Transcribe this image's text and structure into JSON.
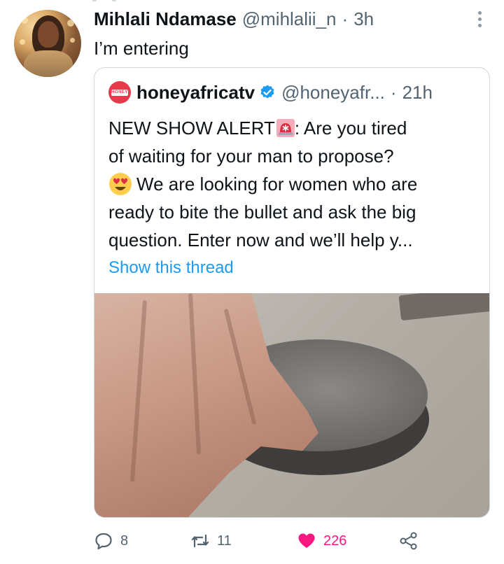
{
  "tweet": {
    "author_name": "Mihlali Ndamase",
    "author_handle": "@mihlalii_n",
    "separator": "·",
    "time": "3h",
    "text": "I’m entering"
  },
  "quoted_tweet": {
    "logo_text": "HONEY",
    "author_name": "honeyafricatv",
    "author_handle": "@honeyafr...",
    "separator": "·",
    "time": "21h",
    "text_line1_a": "NEW SHOW ALERT",
    "text_line1_b": ": Are you tired",
    "text_line2": "of waiting for your man to propose?",
    "text_line3": "We are looking for women who are",
    "text_line4": "ready to bite the bullet and ask the big",
    "text_line5": "question. Enter now and we’ll help y...",
    "show_thread": "Show this thread"
  },
  "actions": {
    "replies": "8",
    "retweets": "11",
    "likes": "226"
  },
  "icons": [
    "more-icon",
    "verified-badge-icon",
    "rotating-light-emoji-icon",
    "heart-eyes-emoji-icon",
    "reply-icon",
    "retweet-icon",
    "like-icon",
    "share-icon"
  ],
  "colors": {
    "link": "#1d9bf0",
    "like": "#f91880",
    "secondary_text": "#536471",
    "border": "#cfd9de",
    "verified": "#1d9bf0",
    "brand_logo": "#e8394b"
  }
}
